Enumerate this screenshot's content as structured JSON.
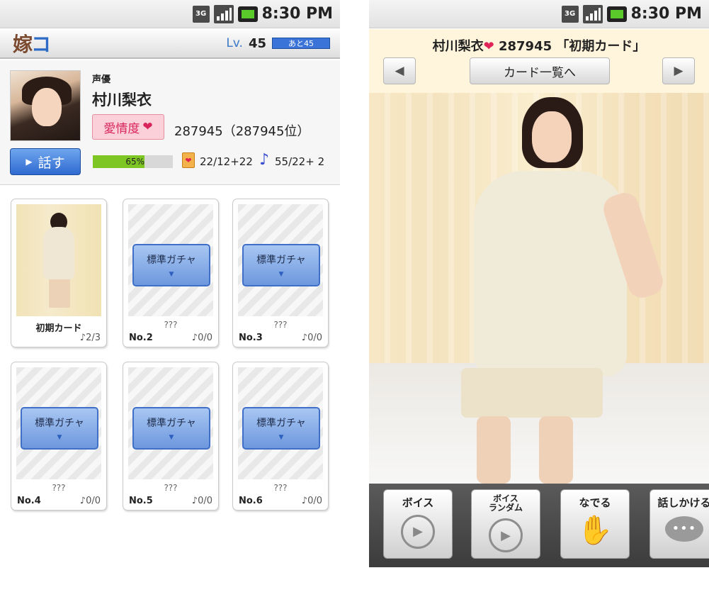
{
  "status_bar": {
    "network": "3G",
    "time": "8:30 PM"
  },
  "left": {
    "logo": {
      "part1": "嫁",
      "part2": "コ"
    },
    "level": {
      "prefix": "Lv.",
      "value": "45",
      "remaining": "あと45"
    },
    "profile": {
      "role": "声優",
      "name": "村川梨衣",
      "affection_label": "愛情度",
      "affection_heart": "❤",
      "score": "287945（287945位）",
      "talk_button": "話す",
      "talk_arrow": "▶",
      "progress_percent": 65,
      "progress_label": "65%",
      "cards_count": "22/12+22",
      "notes_count": "55/22+ 2",
      "cards_icon": "❤",
      "note_icon": "♪"
    },
    "cards": [
      {
        "type": "photo",
        "title": "初期カード",
        "count": "♪2/3"
      },
      {
        "type": "gacha",
        "gacha_label": "標準ガチャ",
        "unknown": "???",
        "number": "No.2",
        "count": "♪0/0"
      },
      {
        "type": "gacha",
        "gacha_label": "標準ガチャ",
        "unknown": "???",
        "number": "No.3",
        "count": "♪0/0"
      },
      {
        "type": "gacha",
        "gacha_label": "標準ガチャ",
        "unknown": "???",
        "number": "No.4",
        "count": "♪0/0"
      },
      {
        "type": "gacha",
        "gacha_label": "標準ガチャ",
        "unknown": "???",
        "number": "No.5",
        "count": "♪0/0"
      },
      {
        "type": "gacha",
        "gacha_label": "標準ガチャ",
        "unknown": "???",
        "number": "No.6",
        "count": "♪0/0"
      }
    ]
  },
  "right": {
    "title_name": "村川梨衣",
    "title_heart": "❤",
    "title_rest": " 287945 「初期カード」",
    "prev_arrow": "◀",
    "next_arrow": "▶",
    "card_list_button": "カード一覧へ",
    "actions": [
      {
        "label": "ボイス",
        "icon": "play-icon"
      },
      {
        "label": "ボイス\nランダム",
        "icon": "play-icon"
      },
      {
        "label": "なでる",
        "icon": "hand-icon"
      },
      {
        "label": "話しかける",
        "icon": "speech-bubble-icon"
      }
    ]
  },
  "colors": {
    "accent_blue": "#3b74d8",
    "heart_pink": "#e0245a",
    "progress_green": "#7ec623"
  }
}
